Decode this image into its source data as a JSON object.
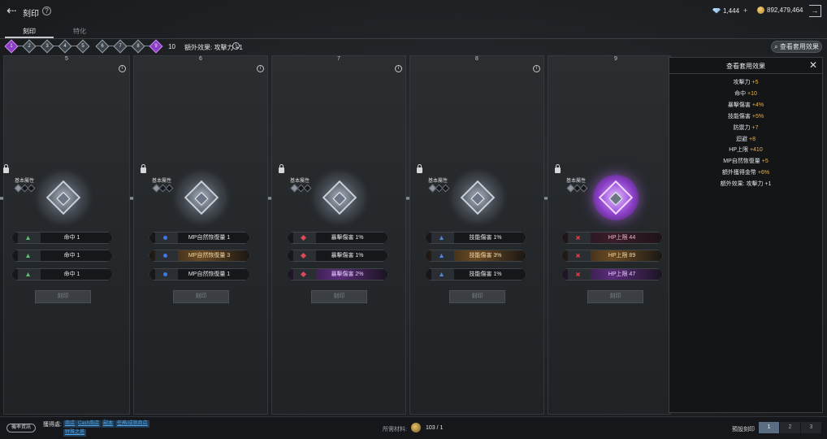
{
  "header": {
    "title": "刻印",
    "currency1": "1,444",
    "currency2": "892,479,464",
    "icons": [
      "back-icon",
      "help-icon",
      "diamond-icon",
      "coin-icon",
      "exit-icon"
    ]
  },
  "tabs": [
    {
      "label": "刻印"
    },
    {
      "label": "特化"
    }
  ],
  "progress": {
    "steps": [
      "1",
      "2",
      "3",
      "4",
      "5",
      "6",
      "7",
      "8",
      "9"
    ],
    "current": "9",
    "count": "10",
    "bonus": "額外效果: 攻擊力 +1"
  },
  "set_effect_button": "查看套用效果",
  "columns": [
    {
      "number": "5",
      "base_label": "基本屬性",
      "stats": [
        {
          "icon": "triangle-green",
          "text": "命中 1",
          "style": "normal"
        },
        {
          "icon": "triangle-green",
          "text": "命中 1",
          "style": "normal"
        },
        {
          "icon": "triangle-green",
          "text": "命中 1",
          "style": "normal"
        }
      ],
      "button": "刻印"
    },
    {
      "number": "6",
      "base_label": "基本屬性",
      "stats": [
        {
          "icon": "dot-blue",
          "text": "MP自然恢復量 1",
          "style": "normal"
        },
        {
          "icon": "dot-blue",
          "text": "MP自然恢復量 3",
          "style": "gold"
        },
        {
          "icon": "dot-blue",
          "text": "MP自然恢復量 1",
          "style": "normal"
        }
      ],
      "button": "刻印"
    },
    {
      "number": "7",
      "base_label": "基本屬性",
      "stats": [
        {
          "icon": "diamond-red",
          "text": "暴擊傷害 1%",
          "style": "normal"
        },
        {
          "icon": "diamond-red",
          "text": "暴擊傷害 1%",
          "style": "normal"
        },
        {
          "icon": "diamond-red",
          "text": "暴擊傷害 2%",
          "style": "purple"
        }
      ],
      "button": "刻印"
    },
    {
      "number": "8",
      "base_label": "基本屬性",
      "stats": [
        {
          "icon": "triangle-blue",
          "text": "技能傷害 1%",
          "style": "normal"
        },
        {
          "icon": "triangle-blue",
          "text": "技能傷害 3%",
          "style": "gold"
        },
        {
          "icon": "triangle-blue",
          "text": "技能傷害 1%",
          "style": "normal"
        }
      ],
      "button": "刻印"
    },
    {
      "number": "9",
      "base_label": "基本屬性",
      "stats": [
        {
          "icon": "cross-red",
          "text": "HP上限 44",
          "style": "red"
        },
        {
          "icon": "cross-red",
          "text": "HP上限 89",
          "style": "gold"
        },
        {
          "icon": "cross-red",
          "text": "HP上限 47",
          "style": "purple"
        }
      ],
      "button": "刻印"
    }
  ],
  "panel": {
    "title": "查看套用效果",
    "lines": [
      {
        "name": "攻擊力",
        "value": "+5"
      },
      {
        "name": "命中",
        "value": "+10"
      },
      {
        "name": "暴擊傷害",
        "value": "+4%"
      },
      {
        "name": "技能傷害",
        "value": "+5%"
      },
      {
        "name": "防禦力",
        "value": "+7"
      },
      {
        "name": "迴避",
        "value": "+8"
      },
      {
        "name": "HP上限",
        "value": "+410"
      },
      {
        "name": "MP自然恢復量",
        "value": "+5"
      },
      {
        "name": "額外獲得金幣",
        "value": "+6%"
      },
      {
        "name": "額外效果: 攻擊力",
        "value": "+1"
      }
    ]
  },
  "bottom": {
    "rate_info": "機率資訊",
    "obtain_label": "獲得處:",
    "sources": [
      "商店",
      "Cash商店",
      "副本",
      "任務/成就商店",
      "特殊之塔"
    ],
    "material_label": "所需材料:",
    "material_count": "103 / 1",
    "preset_label": "預設刻印",
    "presets": [
      "1",
      "2",
      "3"
    ]
  }
}
